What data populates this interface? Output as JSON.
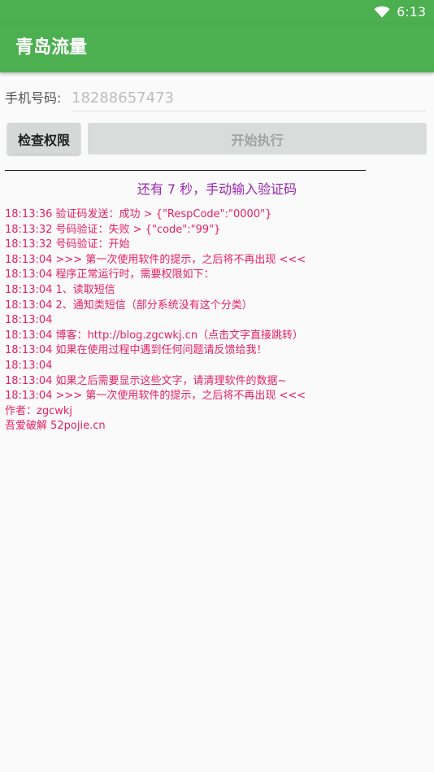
{
  "status_bar": {
    "time": "6:13",
    "icons": [
      "wifi-icon"
    ],
    "color": "#4caf50"
  },
  "app_bar": {
    "title": "青岛流量",
    "color": "#4caf50"
  },
  "phone": {
    "label": "手机号码:",
    "value": "",
    "placeholder": "18288657473"
  },
  "buttons": {
    "check_label": "检查权限",
    "start_label": "开始执行"
  },
  "countdown": {
    "text": "还有 7 秒，手动输入验证码",
    "color": "#9c27b0"
  },
  "log": {
    "color": "#e91e63",
    "lines": [
      "18:13:36 验证码发送：成功 > {\"RespCode\":\"0000\"}",
      "18:13:32 号码验证：失败 > {\"code\":\"99\"}",
      "18:13:32 号码验证：开始",
      "18:13:04 >>> 第一次使用软件的提示，之后将不再出现 <<<",
      "18:13:04 程序正常运行时，需要权限如下：",
      "18:13:04 1、读取短信",
      "18:13:04 2、通知类短信（部分系统没有这个分类）",
      "18:13:04",
      "18:13:04 博客：http://blog.zgcwkj.cn（点击文字直接跳转）",
      "18:13:04 如果在使用过程中遇到任何问题请反馈给我！",
      "18:13:04",
      "18:13:04 如果之后需要显示这些文字，请清理软件的数据~",
      "18:13:04 >>> 第一次使用软件的提示，之后将不再出现 <<<",
      "作者：zgcwkj",
      "吾爱破解 52pojie.cn"
    ]
  }
}
